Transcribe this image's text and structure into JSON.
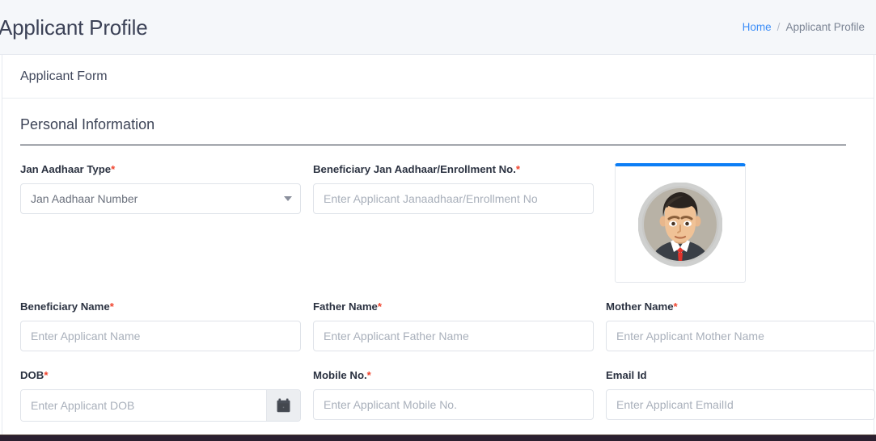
{
  "header": {
    "title": "Applicant Profile",
    "breadcrumb": {
      "home": "Home",
      "separator": "/",
      "current": "Applicant Profile"
    }
  },
  "card": {
    "header_title": "Applicant Form",
    "section_title": "Personal Information"
  },
  "fields": {
    "jan_aadhaar_type": {
      "label": "Jan Aadhaar Type",
      "required": "*",
      "value": "Jan Aadhaar Number",
      "icon": "chevron-down-icon"
    },
    "beneficiary_jan_aadhaar_no": {
      "label": "Beneficiary Jan Aadhaar/Enrollment No.",
      "required": "*",
      "value": "",
      "placeholder": "Enter Applicant Janaadhaar/Enrollment No"
    },
    "beneficiary_name": {
      "label": "Beneficiary Name",
      "required": "*",
      "value": "",
      "placeholder": "Enter Applicant Name"
    },
    "father_name": {
      "label": "Father Name",
      "required": "*",
      "value": "",
      "placeholder": "Enter Applicant Father Name"
    },
    "mother_name": {
      "label": "Mother Name",
      "required": "*",
      "value": "",
      "placeholder": "Enter Applicant Mother Name"
    },
    "dob": {
      "label": "DOB",
      "required": "*",
      "value": "",
      "placeholder": "Enter Applicant DOB",
      "icon": "calendar-icon"
    },
    "mobile_no": {
      "label": "Mobile No.",
      "required": "*",
      "value": "",
      "placeholder": "Enter Applicant Mobile No."
    },
    "email_id": {
      "label": "Email Id",
      "required": "",
      "value": "",
      "placeholder": "Enter Applicant EmailId"
    }
  },
  "photo": {
    "icon": "applicant-avatar-photo"
  },
  "colors": {
    "accent_blue": "#0d7ef5",
    "link_blue": "#3d8ef8",
    "required_red": "#f0452f",
    "page_bg": "#f5f7fa",
    "border": "#dfe3e9",
    "text": "#2b3241"
  }
}
